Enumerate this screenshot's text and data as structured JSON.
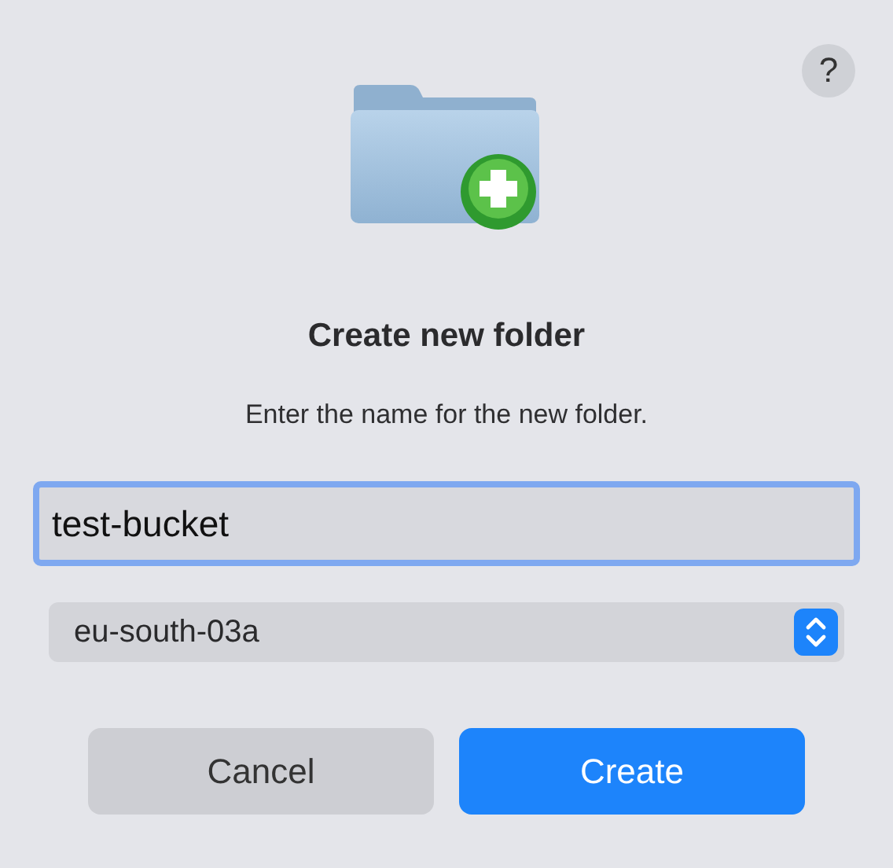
{
  "help_button": {
    "label": "?"
  },
  "title": "Create new folder",
  "message": "Enter the name for the new folder.",
  "name_field": {
    "value": "test-bucket",
    "focused": true
  },
  "location_select": {
    "value": "eu-south-03a"
  },
  "buttons": [
    {
      "label": "Cancel",
      "kind": "secondary"
    },
    {
      "label": "Create",
      "kind": "primary"
    }
  ]
}
